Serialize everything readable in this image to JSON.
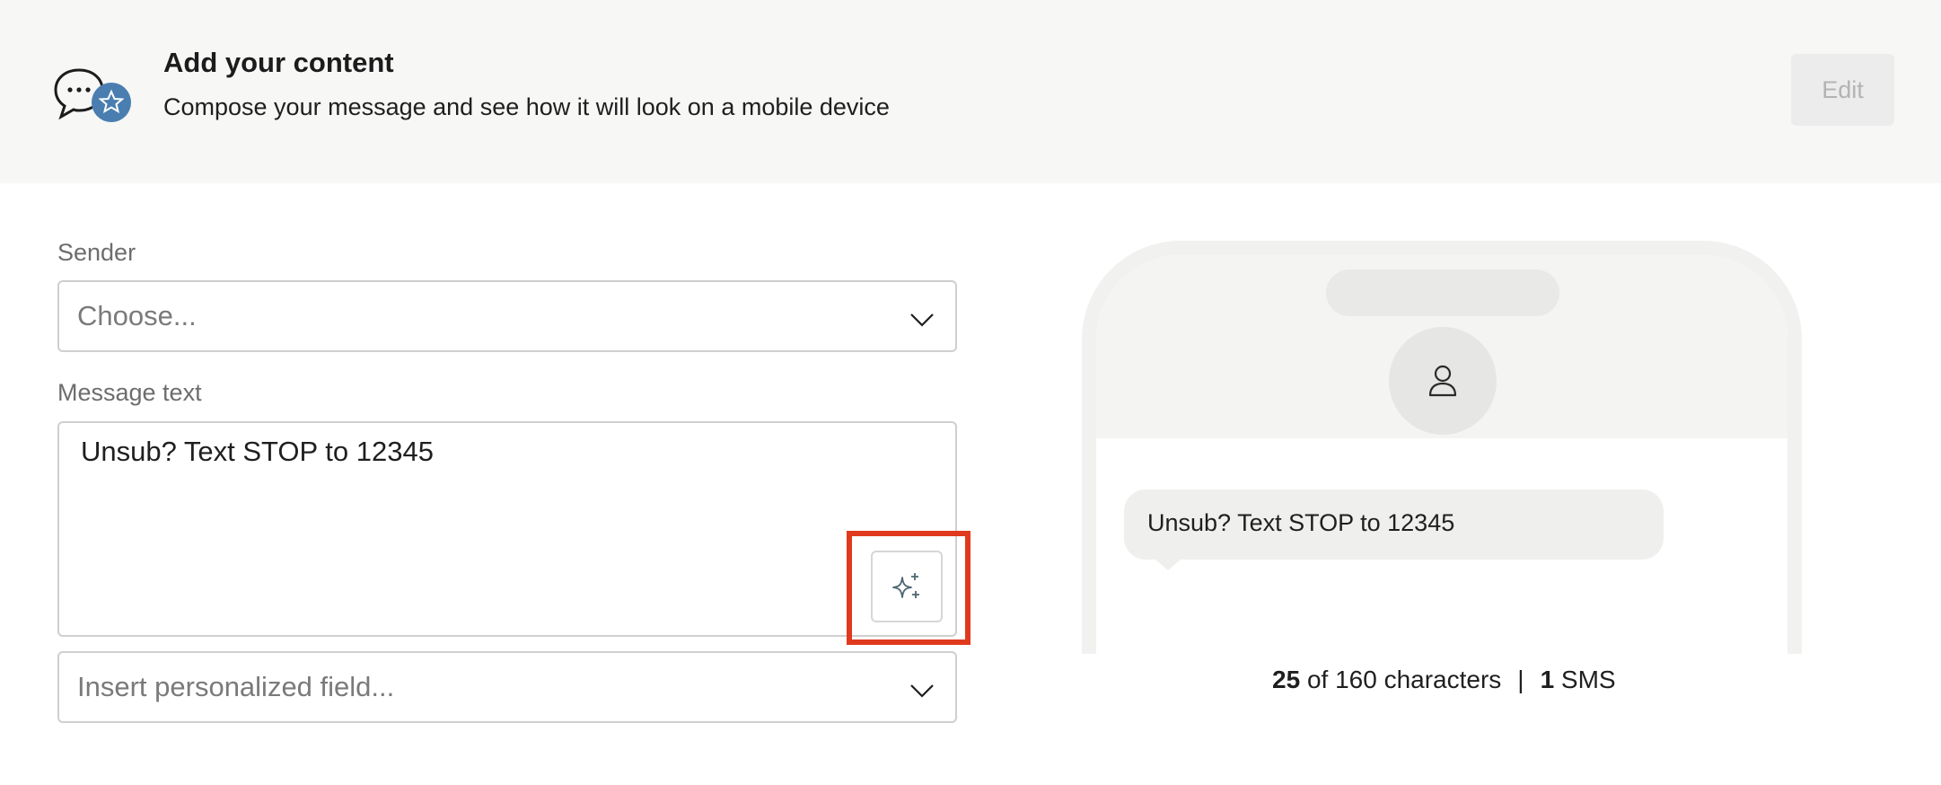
{
  "header": {
    "title": "Add your content",
    "subtitle": "Compose your message and see how it will look on a mobile device",
    "icon": "chat-bubble-star-icon",
    "edit_label": "Edit",
    "badge_color": "#4a7eb0"
  },
  "form": {
    "sender_label": "Sender",
    "sender_placeholder": "Choose...",
    "message_label": "Message text",
    "message_value": "Unsub? Text STOP to 12345",
    "ai_button_icon": "sparkle-plus-icon",
    "personalize_placeholder": "Insert personalized field..."
  },
  "preview": {
    "bubble_text": "Unsub? Text STOP to 12345",
    "avatar_icon": "person-icon",
    "char_count": "25",
    "char_text": "of 160 characters",
    "separator": "|",
    "sms_count": "1",
    "sms_text": "SMS"
  },
  "colors": {
    "highlight": "#e03a1e",
    "header_bg": "#f7f7f6"
  }
}
